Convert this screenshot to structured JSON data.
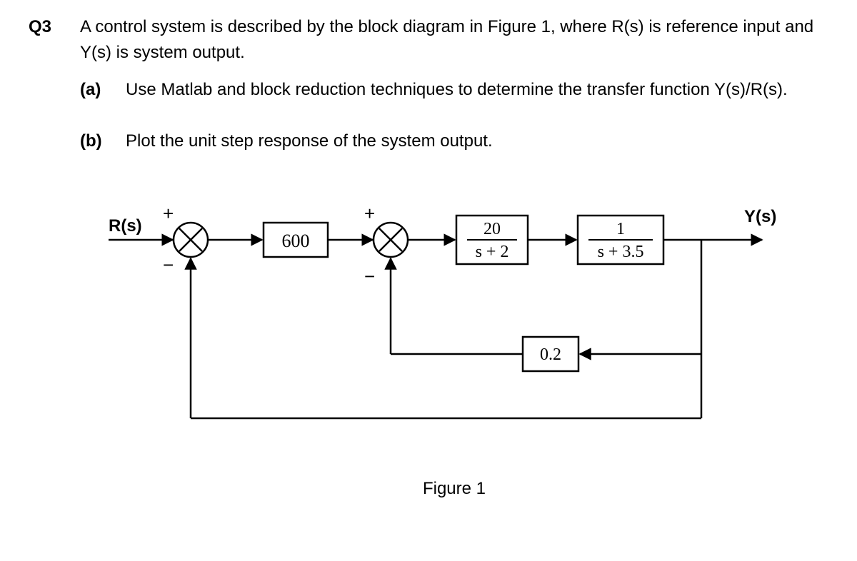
{
  "question": {
    "number": "Q3",
    "intro": "A control system is described by the block diagram in Figure 1, where R(s) is reference input and Y(s) is system output.",
    "parts": {
      "a": {
        "label": "(a)",
        "text": "Use Matlab and block reduction techniques to determine the  transfer function Y(s)/R(s)."
      },
      "b": {
        "label": "(b)",
        "text": "Plot the unit step response of the system output."
      }
    }
  },
  "diagram": {
    "input_label": "R(s)",
    "output_label": "Y(s)",
    "caption": "Figure 1",
    "sum1": {
      "top": "+",
      "bottom": "−"
    },
    "sum2": {
      "top": "+",
      "bottom": "−"
    },
    "blocks": {
      "g1": "600",
      "g2_num": "20",
      "g2_den": "s + 2",
      "g3_num": "1",
      "g3_den": "s + 3.5",
      "h1": "0.2"
    }
  }
}
